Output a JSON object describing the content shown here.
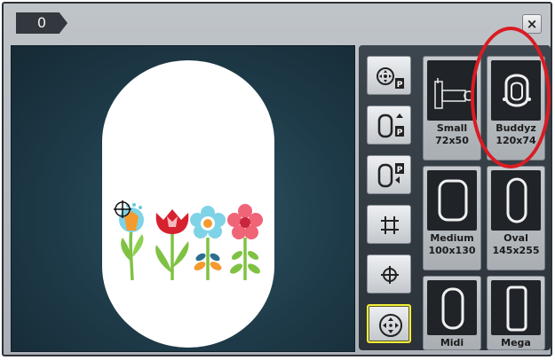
{
  "titlebar": {
    "hoop_indicator": "0",
    "close_label": "×"
  },
  "tools": [
    {
      "name": "move-design-to-park-button",
      "icon": "move-to-park-icon"
    },
    {
      "name": "hoop-park-up-button",
      "icon": "hoop-park-up-icon"
    },
    {
      "name": "hoop-park-left-button",
      "icon": "hoop-park-left-icon"
    },
    {
      "name": "grid-button",
      "icon": "grid-icon"
    },
    {
      "name": "center-button",
      "icon": "crosshair-icon"
    },
    {
      "name": "move-hoop-button",
      "icon": "move-hoop-icon",
      "active": true
    }
  ],
  "hoops": [
    {
      "name": "Small",
      "size": "72x50"
    },
    {
      "name": "Buddyz",
      "size": "120x74"
    },
    {
      "name": "Medium",
      "size": "100x130"
    },
    {
      "name": "Oval",
      "size": "145x255"
    },
    {
      "name": "Midi",
      "size": ""
    },
    {
      "name": "Mega",
      "size": ""
    }
  ],
  "colors": {
    "active_tool_border": "#f2ef3a",
    "annotation_circle": "#d91c23",
    "preview_background": "#1e3a48"
  }
}
